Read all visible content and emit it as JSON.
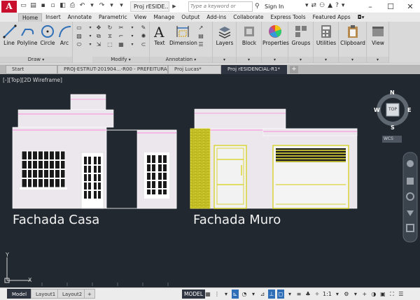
{
  "window": {
    "app_button_label": "A",
    "document_tab": "Proj rESIDE...",
    "search_placeholder": "Type a keyword or phrase",
    "sign_in": "Sign In"
  },
  "ribbon": {
    "tabs": [
      "Home",
      "Insert",
      "Annotate",
      "Parametric",
      "View",
      "Manage",
      "Output",
      "Add-ins",
      "Collaborate",
      "Express Tools",
      "Featured Apps"
    ],
    "active_tab": "Home",
    "draw_panel": {
      "title": "Draw",
      "line": "Line",
      "polyline": "Polyline",
      "circle": "Circle",
      "arc": "Arc"
    },
    "modify_panel": {
      "title": "Modify"
    },
    "annotation_panel": {
      "title": "Annotation",
      "text": "Text",
      "dimension": "Dimension"
    },
    "layers": "Layers",
    "block": "Block",
    "properties": "Properties",
    "groups": "Groups",
    "utilities": "Utilities",
    "clipboard": "Clipboard",
    "view": "View"
  },
  "file_tabs": {
    "items": [
      "Start",
      "PROJ-ESTRUT-201904...-R00 - PREFEITURA*",
      "Proj Lucas*",
      "Proj rESIDENCIAL-R1*"
    ],
    "active_index": 3
  },
  "viewport": {
    "label": "[-][Top][2D Wireframe]",
    "caption_left": "Fachada Casa",
    "caption_right": "Fachada Muro",
    "viewcube_top": "TOP",
    "compass_n": "N",
    "compass_s": "S",
    "compass_e": "E",
    "compass_w": "W",
    "wcs": "WCS",
    "ucs_y": "Y",
    "ucs_x": "X"
  },
  "statusbar": {
    "layouts": [
      "Model",
      "Layout1",
      "Layout2"
    ],
    "active_layout": "Model",
    "model_button": "MODEL",
    "scale": "1:1"
  },
  "colors": {
    "canvas": "#212830",
    "building_fill": "#ebe7ec",
    "pink_band": "#f3b9e4",
    "window_white": "#ffffff",
    "hatch_yellow": "#cfca29",
    "accent_blue": "#2f6fb8"
  }
}
